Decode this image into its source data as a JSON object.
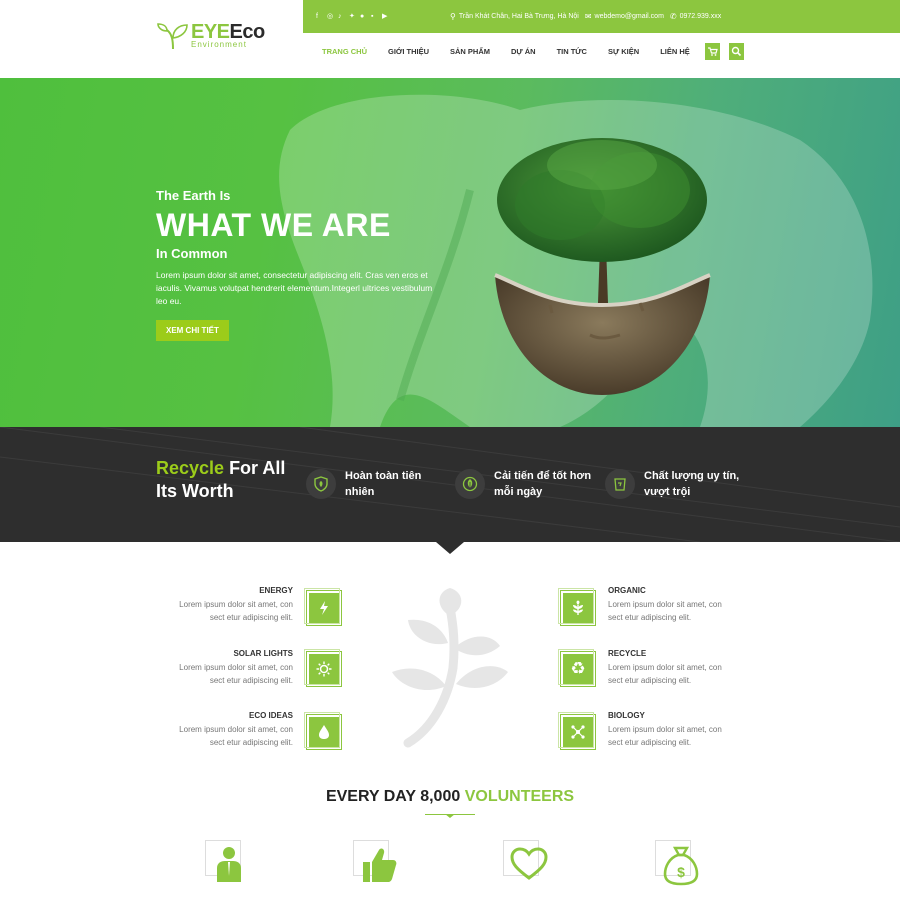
{
  "brand": {
    "name_main": "EYE",
    "name_second": "Eco",
    "tagline": "Environment"
  },
  "topbar": {
    "social_icons": [
      "facebook-icon",
      "instagram-icon",
      "tiktok-icon",
      "twitter-icon",
      "pinterest-icon",
      "linkedin-icon",
      "youtube-icon"
    ],
    "address": "Trần Khát Chân, Hai Bà Trưng, Hà Nội",
    "email": "webdemo@gmail.com",
    "phone": "0972.939.xxx"
  },
  "nav": {
    "items": [
      "TRANG CHỦ",
      "GIỚI THIỆU",
      "SẢN PHẨM",
      "DỰ ÁN",
      "TIN TỨC",
      "SỰ KIỆN",
      "LIÊN HỆ"
    ],
    "active_index": 0
  },
  "hero": {
    "kicker": "The Earth Is",
    "title": "WHAT WE ARE",
    "subtitle": "In Common",
    "description": "Lorem ipsum dolor sit amet, consectetur adipiscing elit. Cras ven eros et iaculis. Vivamus volutpat hendrerit elementum.Integerl ultrices vestibulum leo eu.",
    "button": "XEM CHI TIẾT"
  },
  "band": {
    "title_hl": "Recycle",
    "title_rest": " For All",
    "title_line2": "Its Worth",
    "features": [
      {
        "line1": "Hoàn toàn tiên",
        "line2": "nhiên",
        "icon": "shield-leaf-icon"
      },
      {
        "line1": "Cải tiến để tốt hơn",
        "line2": "mỗi ngày",
        "icon": "leaf-circle-icon"
      },
      {
        "line1": "Chất lượng uy tín,",
        "line2": "vượt trội",
        "icon": "recycle-bin-icon"
      }
    ]
  },
  "services": {
    "left": [
      {
        "title": "ENERGY",
        "desc1": "Lorem ipsum dolor sit amet, con",
        "desc2": "sect etur adipiscing elit.",
        "icon": "lightning-icon"
      },
      {
        "title": "SOLAR LIGHTS",
        "desc1": "Lorem ipsum dolor sit amet, con",
        "desc2": "sect etur adipiscing elit.",
        "icon": "sun-icon"
      },
      {
        "title": "ECO IDEAS",
        "desc1": "Lorem ipsum dolor sit amet, con",
        "desc2": "sect etur adipiscing elit.",
        "icon": "water-drop-icon"
      }
    ],
    "right": [
      {
        "title": "ORGANIC",
        "desc1": "Lorem ipsum dolor sit amet, con",
        "desc2": "sect etur adipiscing elit.",
        "icon": "plant-icon"
      },
      {
        "title": "RECYCLE",
        "desc1": "Lorem ipsum dolor sit amet, con",
        "desc2": "sect etur adipiscing elit.",
        "icon": "recycle-icon"
      },
      {
        "title": "BIOLOGY",
        "desc1": "Lorem ipsum dolor sit amet, con",
        "desc2": "sect etur adipiscing elit.",
        "icon": "molecule-icon"
      }
    ]
  },
  "volunteers": {
    "title_prefix": "EVERY DAY 8,000 ",
    "title_hl": "VOLUNTEERS",
    "icons": [
      "person-icon",
      "thumbs-up-icon",
      "heart-icon",
      "money-bag-icon"
    ]
  },
  "colors": {
    "accent": "#8cc63f",
    "dark": "#2e2e2e",
    "button": "#9ccc1a"
  }
}
